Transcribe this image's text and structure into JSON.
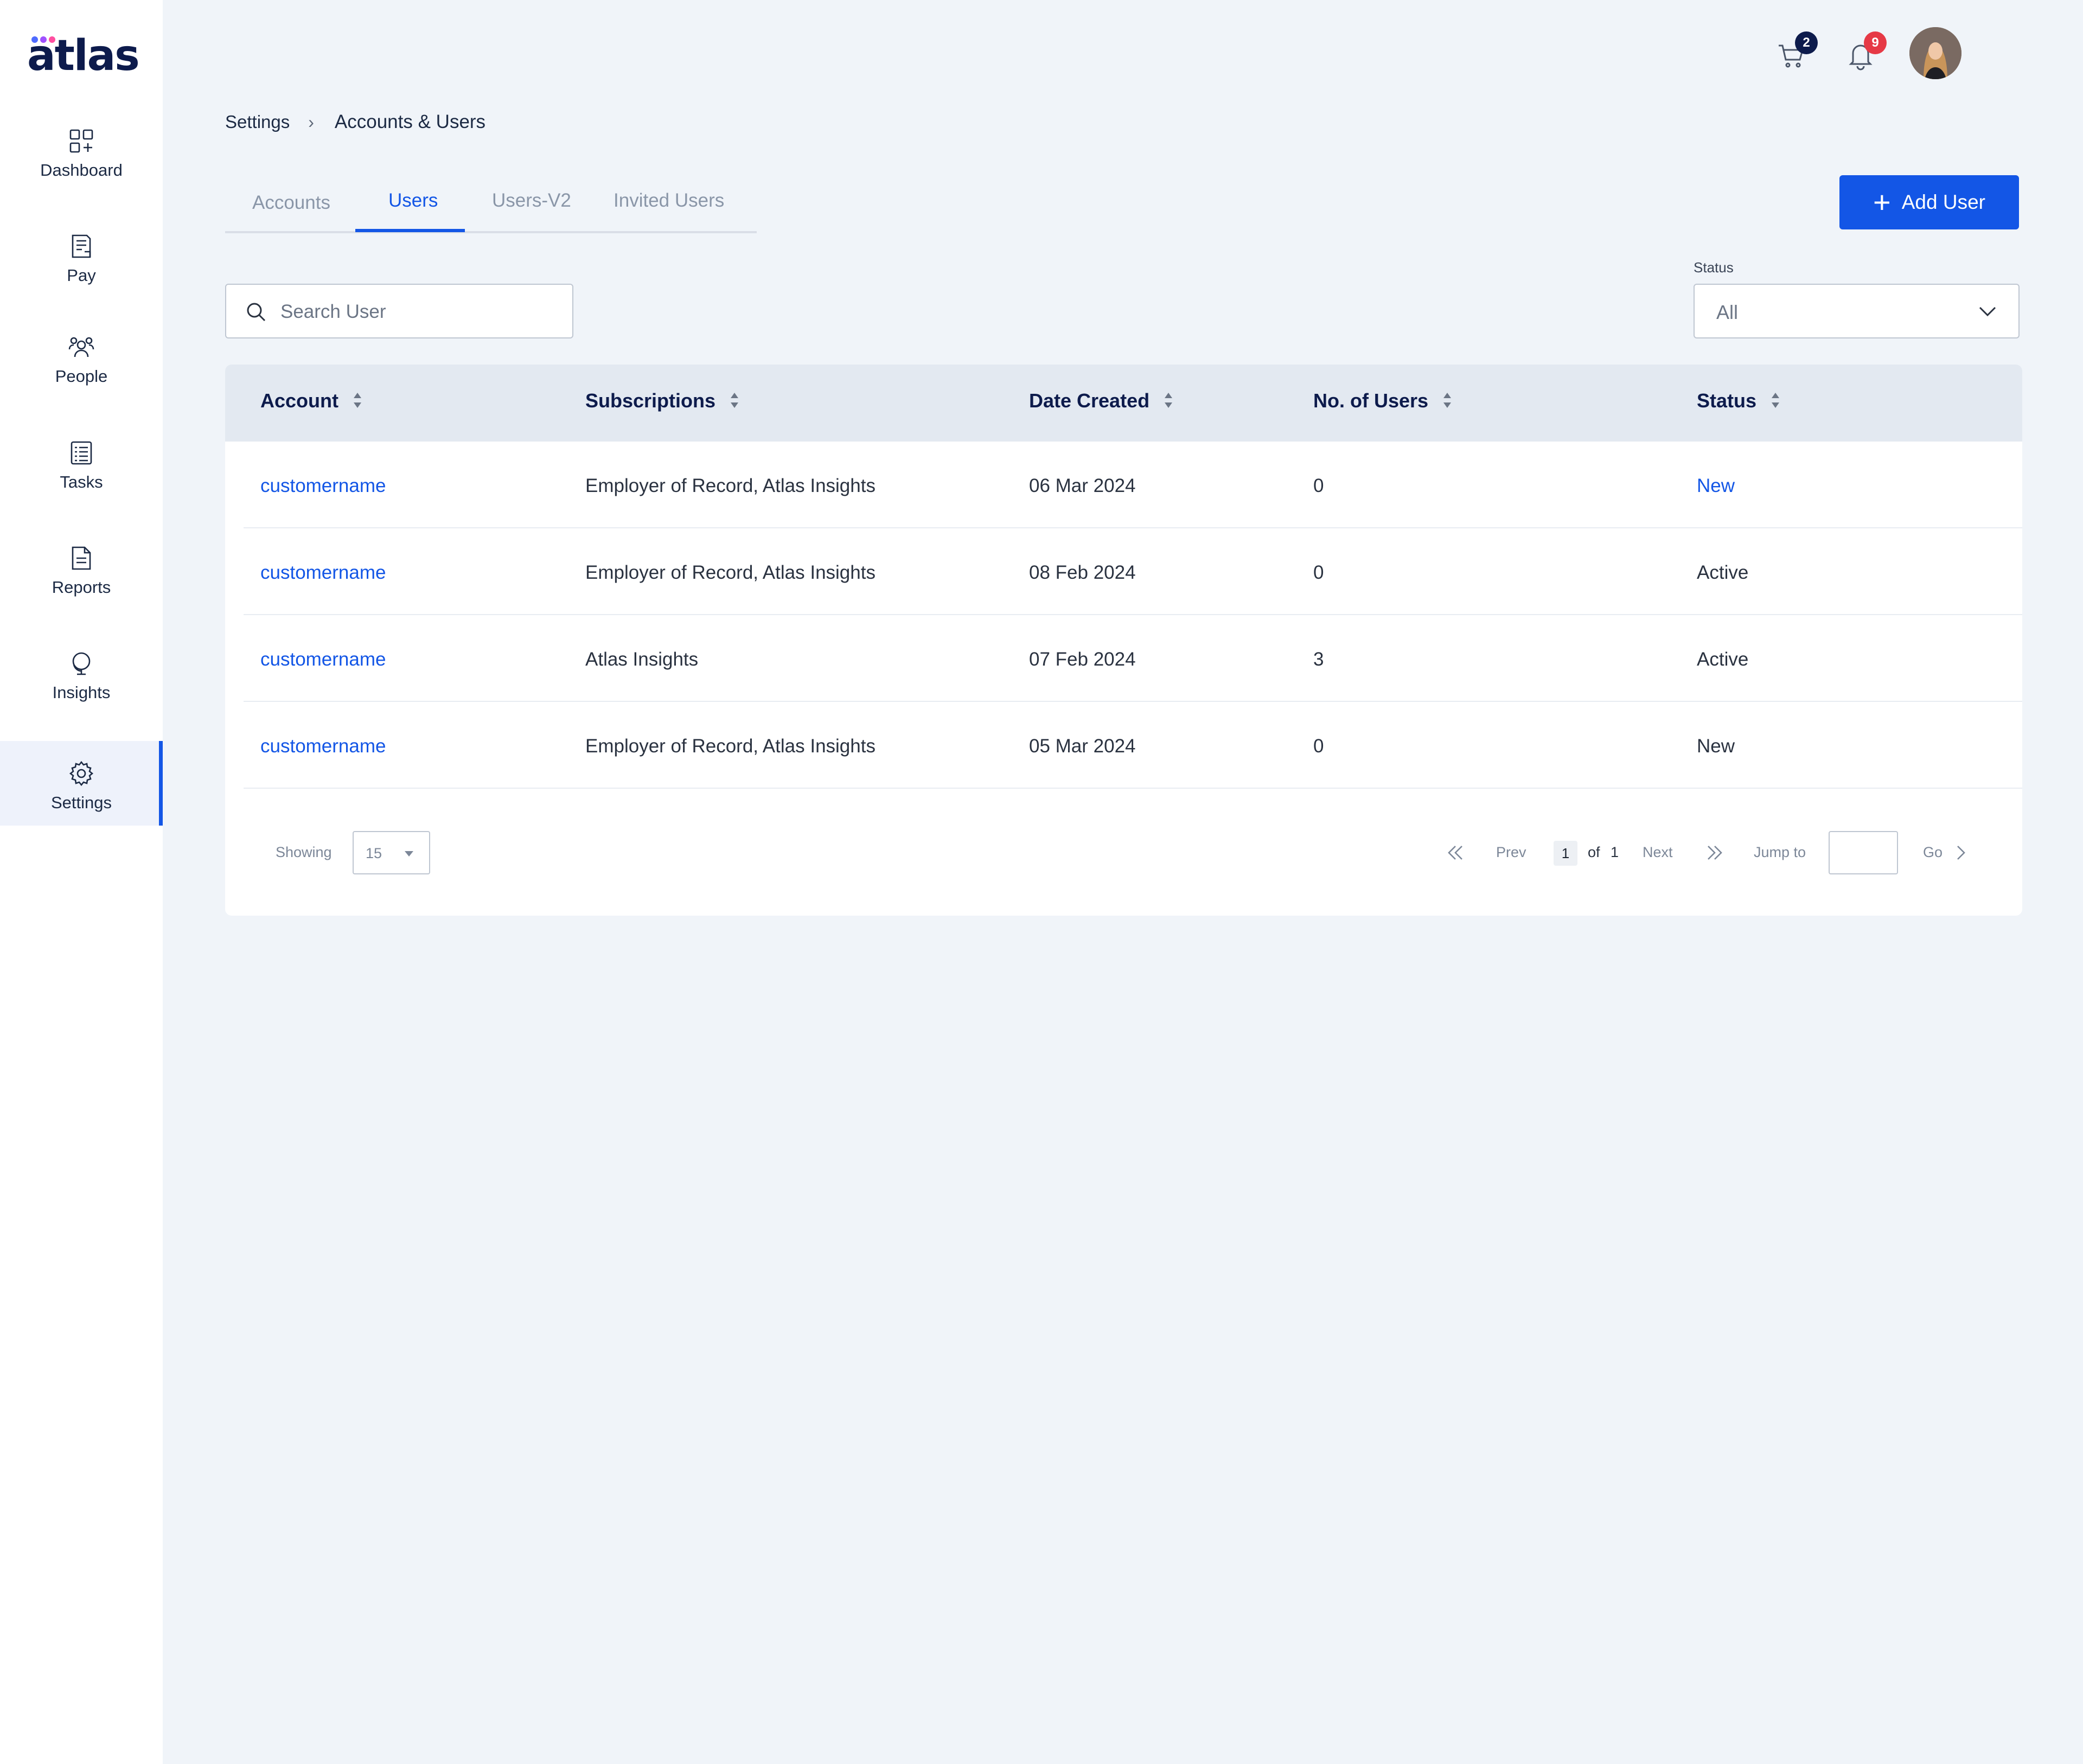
{
  "brand": {
    "name": "atlas",
    "dot_colors": [
      "#4f6bff",
      "#a050ff",
      "#ff4fa0"
    ]
  },
  "sidebar": {
    "items": [
      {
        "label": "Dashboard",
        "icon": "dashboard-icon"
      },
      {
        "label": "Pay",
        "icon": "pay-icon"
      },
      {
        "label": "People",
        "icon": "people-icon"
      },
      {
        "label": "Tasks",
        "icon": "tasks-icon"
      },
      {
        "label": "Reports",
        "icon": "reports-icon"
      },
      {
        "label": "Insights",
        "icon": "insights-icon"
      },
      {
        "label": "Settings",
        "icon": "gear-icon",
        "active": true
      }
    ]
  },
  "topbar": {
    "cart_count": "2",
    "notification_count": "9",
    "cart_badge_color": "#0d1b4c",
    "notification_badge_color": "#e63946"
  },
  "breadcrumb": {
    "items": [
      "Settings",
      "Accounts & Users"
    ],
    "separator": "›"
  },
  "tabs": {
    "items": [
      "Accounts",
      "Users",
      "Users-V2",
      "Invited Users"
    ],
    "active": "Users"
  },
  "actions": {
    "add_user_label": "Add User"
  },
  "filters": {
    "search_placeholder": "Search User",
    "status_label": "Status",
    "status_value": "All"
  },
  "table": {
    "columns": [
      "Account",
      "Subscriptions",
      "Date Created",
      "No. of Users",
      "Status"
    ],
    "rows": [
      {
        "account": "customername",
        "subscriptions": "Employer of Record, Atlas Insights",
        "date_created": "06 Mar 2024",
        "users": "0",
        "status": "New"
      },
      {
        "account": "customername",
        "subscriptions": "Employer of Record, Atlas Insights",
        "date_created": "08 Feb 2024",
        "users": "0",
        "status": "Active"
      },
      {
        "account": "customername",
        "subscriptions": "Atlas Insights",
        "date_created": "07 Feb 2024",
        "users": "3",
        "status": "Active"
      },
      {
        "account": "customername",
        "subscriptions": "Employer of Record, Atlas Insights",
        "date_created": "05 Mar 2024",
        "users": "0",
        "status": "New"
      }
    ]
  },
  "pagination": {
    "showing_label": "Showing",
    "page_size": "15",
    "prev_label": "Prev",
    "current_page": "1",
    "of_label": "of",
    "total_pages": "1",
    "next_label": "Next",
    "jump_label": "Jump to",
    "go_label": "Go"
  },
  "colors": {
    "accent": "#1356e6",
    "brand_navy": "#0d1b4c",
    "page_bg": "#f0f4f9"
  }
}
